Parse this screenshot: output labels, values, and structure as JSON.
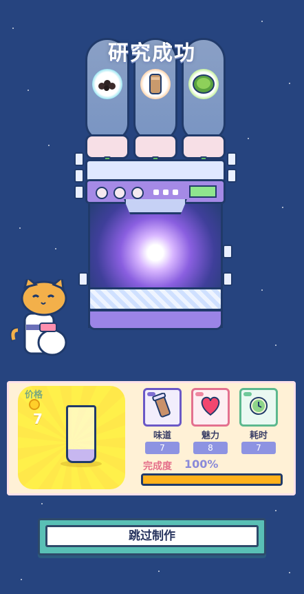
{
  "title": "研究成功",
  "recipe": {
    "price_label": "价格",
    "price_value": "7"
  },
  "stats": [
    {
      "name": "味道",
      "value": "7",
      "icon": "drink-icon"
    },
    {
      "name": "魅力",
      "value": "8",
      "icon": "heart-icon"
    },
    {
      "name": "耗时",
      "value": "7",
      "icon": "clock-icon"
    }
  ],
  "completion": {
    "label": "完成度",
    "value_text": "100%",
    "percent": 100
  },
  "skip_button": {
    "label": "跳过制作"
  },
  "colors": {
    "background": "#26447f",
    "progress": "#ffb11b",
    "button": "#59c0b5"
  }
}
